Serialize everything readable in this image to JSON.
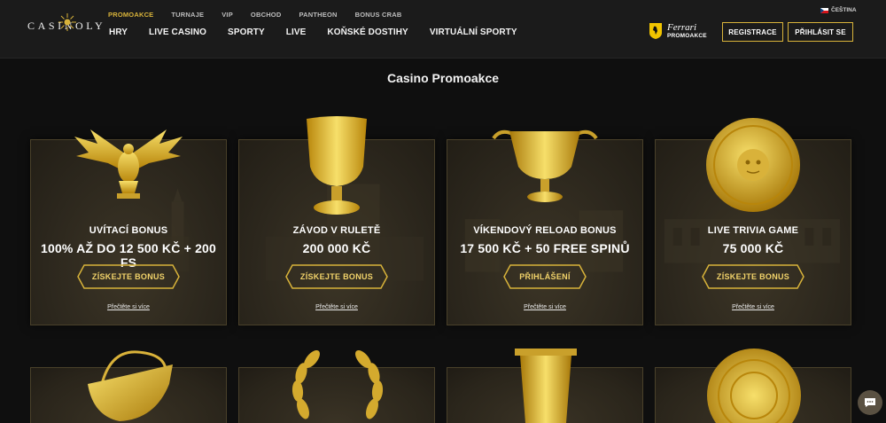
{
  "header": {
    "logo_text": "CASINOLY",
    "subnav": [
      {
        "label": "PROMOAKCE",
        "active": true
      },
      {
        "label": "TURNAJE",
        "active": false
      },
      {
        "label": "VIP",
        "active": false
      },
      {
        "label": "OBCHOD",
        "active": false
      },
      {
        "label": "PANTHEON",
        "active": false
      },
      {
        "label": "BONUS CRAB",
        "active": false
      }
    ],
    "mainnav": [
      "HRY",
      "LIVE CASINO",
      "SPORTY",
      "LIVE",
      "KOŇSKÉ DOSTIHY",
      "VIRTUÁLNÍ SPORTY"
    ],
    "ferrari_brand": "Ferrari",
    "ferrari_sub": "PROMOAKCE",
    "register_label": "REGISTRACE",
    "login_label": "PŘIHLÁSIT SE",
    "language": "ČEŠTINA"
  },
  "page": {
    "title": "Casino Promoakce"
  },
  "cards": [
    {
      "title": "UVÍTACÍ BONUS",
      "amount": "100% AŽ DO 12 500 KČ + 200 FS",
      "button": "ZÍSKEJTE BONUS",
      "link": "Přečtěte si více",
      "art": "eagle-icon"
    },
    {
      "title": "ZÁVOD V RULETĚ",
      "amount": "200 000 KČ",
      "button": "ZÍSKEJTE BONUS",
      "link": "Přečtěte si více",
      "art": "goblet-icon"
    },
    {
      "title": "VÍKENDOVÝ RELOAD BONUS",
      "amount": "17 500 KČ + 50 FREE SPINŮ",
      "button": "PŘIHLÁŠENÍ",
      "link": "Přečtěte si více",
      "art": "kylix-icon"
    },
    {
      "title": "LIVE TRIVIA GAME",
      "amount": "75 000 KČ",
      "button": "ZÍSKEJTE BONUS",
      "link": "Přečtěte si více",
      "art": "shield-medusa-icon"
    }
  ],
  "second_row_art": [
    "basket-icon",
    "laurel-wreath-icon",
    "vase-icon",
    "coin-plate-icon"
  ],
  "colors": {
    "gold": "#d8b33a",
    "header_bg": "#1b1b1b",
    "page_bg": "#0f0f0f"
  }
}
